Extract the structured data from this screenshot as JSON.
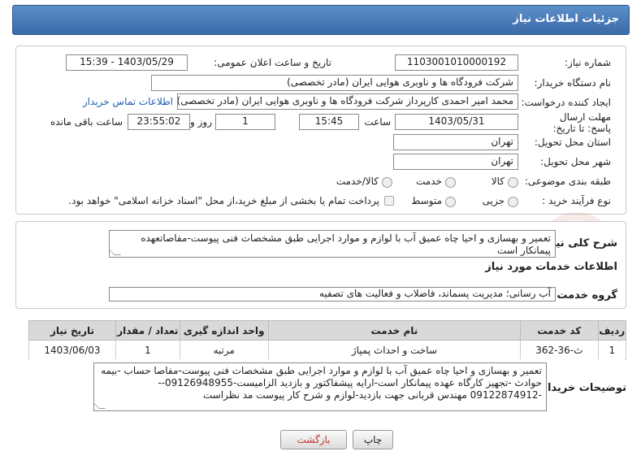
{
  "header": {
    "title": "جزئیات اطلاعات نیاز"
  },
  "form": {
    "need_number_label": "شماره نیاز:",
    "need_number": "1103001010000192",
    "announce_label": "تاریخ و ساعت اعلان عمومی:",
    "announce_value": "1403/05/29 - 15:39",
    "buyer_org_label": "نام دستگاه خریدار:",
    "buyer_org": "شرکت فرودگاه ها و ناوبری هوایی ایران (مادر تخصصی)",
    "creator_label": "ایجاد کننده درخواست:",
    "creator": "محمد امیر احمدی کارپرداز شرکت فرودگاه ها و ناوبری هوایی ایران (مادر تخصصی)",
    "contact_link": "اطلاعات تماس خریدار",
    "deadline_label": "مهلت ارسال پاسخ: تا تاریخ:",
    "deadline_date": "1403/05/31",
    "time_label": "ساعت",
    "deadline_time": "15:45",
    "days_value": "1",
    "days_label": "روز و",
    "remaining_time": "23:55:02",
    "remaining_label": "ساعت باقی مانده",
    "province_label": "استان محل تحویل:",
    "province": "تهران",
    "city_label": "شهر محل تحویل:",
    "city": "تهران",
    "category_label": "طبقه بندی موضوعی:",
    "category_options": [
      "کالا",
      "خدمت",
      "کالا/خدمت"
    ],
    "process_label": "نوع فرآیند خرید :",
    "process_options": [
      "جزیی",
      "متوسط"
    ],
    "treasury_note": "پرداخت تمام یا بخشی از مبلغ خرید،از محل \"اسناد خزانه اسلامی\" خواهد بود."
  },
  "summary": {
    "label": "شرح کلی نیاز:",
    "text": "تعمیر و بهسازی و احیا چاه عمیق آب با لوازم و موارد اجرایی طبق مشخصات فنی پیوست-مفاصاتعهده پیمانکار است",
    "services_title": "اطلاعات خدمات مورد نیاز",
    "group_label": "گروه خدمت:",
    "group_value": "آب رسانی؛ مدیریت پسماند، فاضلاب و فعالیت های تصفیه"
  },
  "table": {
    "headers": [
      "ردیف",
      "کد خدمت",
      "نام خدمت",
      "واحد اندازه گیری",
      "تعداد / مقدار",
      "تاریخ نیاز"
    ],
    "rows": [
      [
        "1",
        "ث-36-362",
        "ساخت و احداث پمپاژ",
        "مرتبه",
        "1",
        "1403/06/03"
      ]
    ]
  },
  "notes": {
    "label": "توضیحات خریدار:",
    "text": "تعمیر و بهسازی و احیا چاه عمیق آب با لوازم و موارد اجرایی طبق مشخصات فنی پیوست-مفاصا حساب -بیمه حوادث -تجهیز کارگاه عهده پیمانکار است-ارایه پیشفاکتور و بازدید الزامیست-09126948955---09122874912 مهندس قربانی جهت بازدید-لوازم و شرح کار پیوست مد نظراست"
  },
  "buttons": {
    "print": "چاپ",
    "back": "بازگشت"
  },
  "colors": {
    "title_bar": "#3a6aa8",
    "link": "#1a5fb4",
    "back_button_text": "#c0392b"
  }
}
